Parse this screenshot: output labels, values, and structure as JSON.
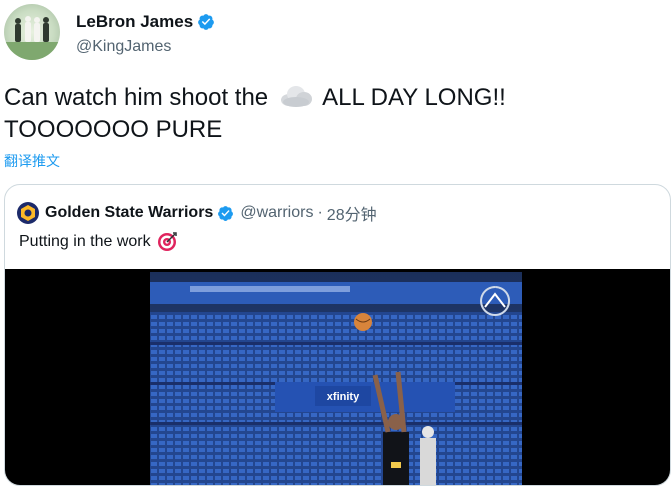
{
  "tweet": {
    "author": {
      "display_name": "LeBron James",
      "handle": "@KingJames"
    },
    "text_line1_before": "Can watch him shoot the",
    "text_line1_after": "ALL DAY LONG!!",
    "text_line2": "TOOOOOOO PURE",
    "emoji": "cloud-icon",
    "translate_label": "翻译推文"
  },
  "quoted": {
    "display_name": "Golden State Warriors",
    "handle": "@warriors",
    "separator": "·",
    "time": "28分钟",
    "text": "Putting in the work",
    "emoji": "direct-hit-icon",
    "media": {
      "type": "video",
      "sign_text": "xfinity"
    }
  },
  "colors": {
    "link_blue": "#1d9bf0",
    "secondary_text": "#536471",
    "border": "#cfd9de",
    "verified": "#1d9bf0"
  }
}
